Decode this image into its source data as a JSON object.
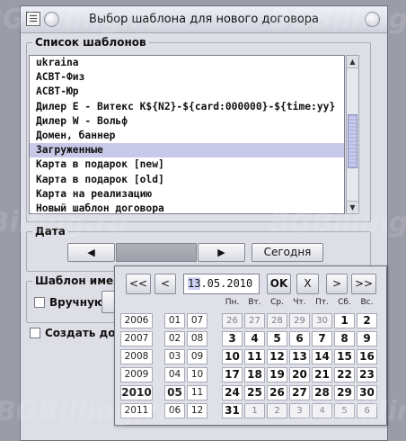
{
  "window": {
    "title": "Выбор шаблона для нового договора"
  },
  "watermark": {
    "text": "BGBilling.ru"
  },
  "templates": {
    "legend": "Список шаблонов",
    "items": [
      {
        "label": "ukraina",
        "selected": false
      },
      {
        "label": "АСВТ-Физ",
        "selected": false
      },
      {
        "label": "АСВТ-Юр",
        "selected": false
      },
      {
        "label": "Дилер  Е - Витекс K${N2}-${card:000000}-${time:yy}",
        "selected": false
      },
      {
        "label": "Дилер  W - Вольф",
        "selected": false
      },
      {
        "label": "Домен,  баннер",
        "selected": false
      },
      {
        "label": "Загруженные",
        "selected": true
      },
      {
        "label": "Карта в подарок [new]",
        "selected": false
      },
      {
        "label": "Карта в подарок [old]",
        "selected": false
      },
      {
        "label": "Карта на реализацию",
        "selected": false
      },
      {
        "label": "Новый шаблон договора",
        "selected": false
      }
    ]
  },
  "date_group": {
    "legend": "Дата",
    "prev_icon": "arrow-left",
    "next_icon": "arrow-right",
    "today_label": "Сегодня"
  },
  "name_group": {
    "legend": "Шаблон имени д",
    "manual_label": "Вручную"
  },
  "create_label": "Создать дого",
  "calendar": {
    "prev_year_label": "<<",
    "prev_month_label": "<",
    "date_day": "13",
    "date_rest": ".05.2010",
    "ok_label": "OK",
    "close_label": "X",
    "next_month_label": ">",
    "next_year_label": ">>",
    "years": [
      "2006",
      "2007",
      "2008",
      "2009",
      "2010",
      "2011"
    ],
    "current_year": "2010",
    "months": [
      "01",
      "07",
      "02",
      "08",
      "03",
      "09",
      "04",
      "10",
      "05",
      "11",
      "06",
      "12"
    ],
    "current_month": "05",
    "weekdays": [
      "Пн.",
      "Вт.",
      "Ср.",
      "Чт.",
      "Пт.",
      "Сб.",
      "Вс."
    ],
    "days": [
      {
        "d": "26",
        "other": true
      },
      {
        "d": "27",
        "other": true
      },
      {
        "d": "28",
        "other": true
      },
      {
        "d": "29",
        "other": true
      },
      {
        "d": "30",
        "other": true
      },
      {
        "d": "1",
        "other": false
      },
      {
        "d": "2",
        "other": false
      },
      {
        "d": "3",
        "other": false
      },
      {
        "d": "4",
        "other": false
      },
      {
        "d": "5",
        "other": false
      },
      {
        "d": "6",
        "other": false
      },
      {
        "d": "7",
        "other": false
      },
      {
        "d": "8",
        "other": false
      },
      {
        "d": "9",
        "other": false
      },
      {
        "d": "10",
        "other": false
      },
      {
        "d": "11",
        "other": false
      },
      {
        "d": "12",
        "other": false
      },
      {
        "d": "13",
        "other": false
      },
      {
        "d": "14",
        "other": false
      },
      {
        "d": "15",
        "other": false
      },
      {
        "d": "16",
        "other": false
      },
      {
        "d": "17",
        "other": false
      },
      {
        "d": "18",
        "other": false
      },
      {
        "d": "19",
        "other": false
      },
      {
        "d": "20",
        "other": false
      },
      {
        "d": "21",
        "other": false
      },
      {
        "d": "22",
        "other": false
      },
      {
        "d": "23",
        "other": false
      },
      {
        "d": "24",
        "other": false
      },
      {
        "d": "25",
        "other": false
      },
      {
        "d": "26",
        "other": false
      },
      {
        "d": "27",
        "other": false
      },
      {
        "d": "28",
        "other": false
      },
      {
        "d": "29",
        "other": false
      },
      {
        "d": "30",
        "other": false
      },
      {
        "d": "31",
        "other": false
      },
      {
        "d": "1",
        "other": true
      },
      {
        "d": "2",
        "other": true
      },
      {
        "d": "3",
        "other": true
      },
      {
        "d": "4",
        "other": true
      },
      {
        "d": "5",
        "other": true
      },
      {
        "d": "6",
        "other": true
      }
    ]
  }
}
